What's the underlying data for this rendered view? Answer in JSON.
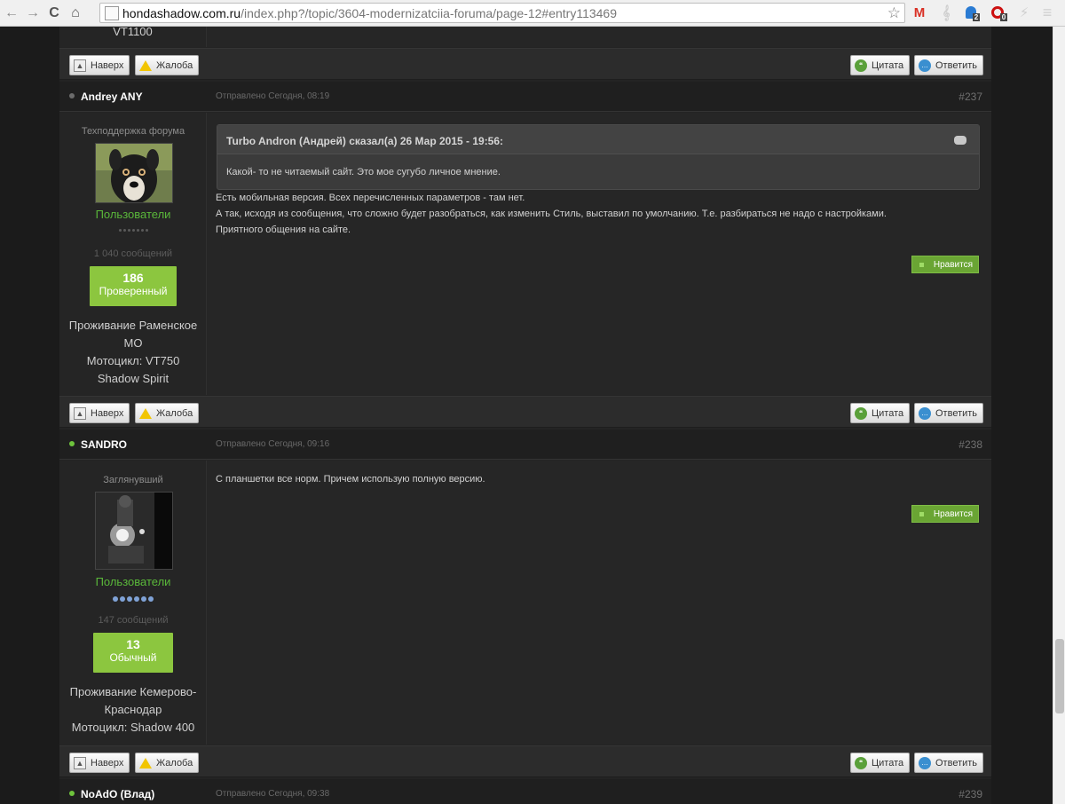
{
  "browser": {
    "url_host": "hondashadow.com.ru",
    "url_rest": "/index.php?/topic/3604-modernizatciia-foruma/page-12#entry113469",
    "extensions": [
      {
        "name": "gmail-icon",
        "label": "M",
        "color": "#d93025"
      },
      {
        "name": "music-icon",
        "label": "𝄞",
        "color": "#333333"
      },
      {
        "name": "ghost-icon",
        "label": "2",
        "color": "#2a7bd3"
      },
      {
        "name": "opera-icon",
        "label": "0",
        "color": "#cc1111"
      },
      {
        "name": "lightning-icon",
        "label": "⚡",
        "color": "#333333"
      },
      {
        "name": "menu-icon",
        "label": "≡",
        "color": "#555555"
      }
    ]
  },
  "buttons": {
    "top": "Наверх",
    "report": "Жалоба",
    "quote": "Цитата",
    "reply": "Ответить",
    "like": "Нравится"
  },
  "prev_post": {
    "info_tail": "VT1100"
  },
  "posts": [
    {
      "author": "Andrey ANY",
      "date": "Отправлено Сегодня, 08:19",
      "number": "#237",
      "role": "Техподдержка форума",
      "group": "Пользователи",
      "posts_count": "1 040 сообщений",
      "rep_value": "186",
      "rep_label": "Проверенный",
      "info": [
        "Проживание Раменское",
        "МО",
        "Мотоцикл: VT750",
        "Shadow Spirit"
      ],
      "quote_author": "Turbo Andron (Андрей) сказал(а) 26 Мар 2015 - 19:56:",
      "quote_text": "Какой- то не читаемый сайт. Это мое сугубо личное мнение.",
      "text": [
        "Есть мобильная версия. Всех перечисленных параметров - там нет.",
        "А так, исходя из сообщения, что сложно будет разобраться, как изменить Стиль, выставил по умолчанию. Т.е. разбираться не надо с настройками.",
        "Приятного общения на сайте."
      ]
    },
    {
      "author": "SANDRO",
      "date": "Отправлено Сегодня, 09:16",
      "number": "#238",
      "role": "Заглянувший",
      "group": "Пользователи",
      "posts_count": "147 сообщений",
      "rep_value": "13",
      "rep_label": "Обычный",
      "info": [
        "Проживание Кемерово-",
        "Краснодар",
        "Мотоцикл: Shadow 400"
      ],
      "text": [
        "С планшетки все норм. Причем использую полную версию."
      ]
    },
    {
      "author": "NoAdO (Влад)",
      "date": "Отправлено Сегодня, 09:38",
      "number": "#239"
    }
  ],
  "colors": {
    "online": "#6ec33c",
    "offline": "#6b6b6b",
    "group_green": "#5ab83a",
    "rep_green": "#8cc63f"
  }
}
